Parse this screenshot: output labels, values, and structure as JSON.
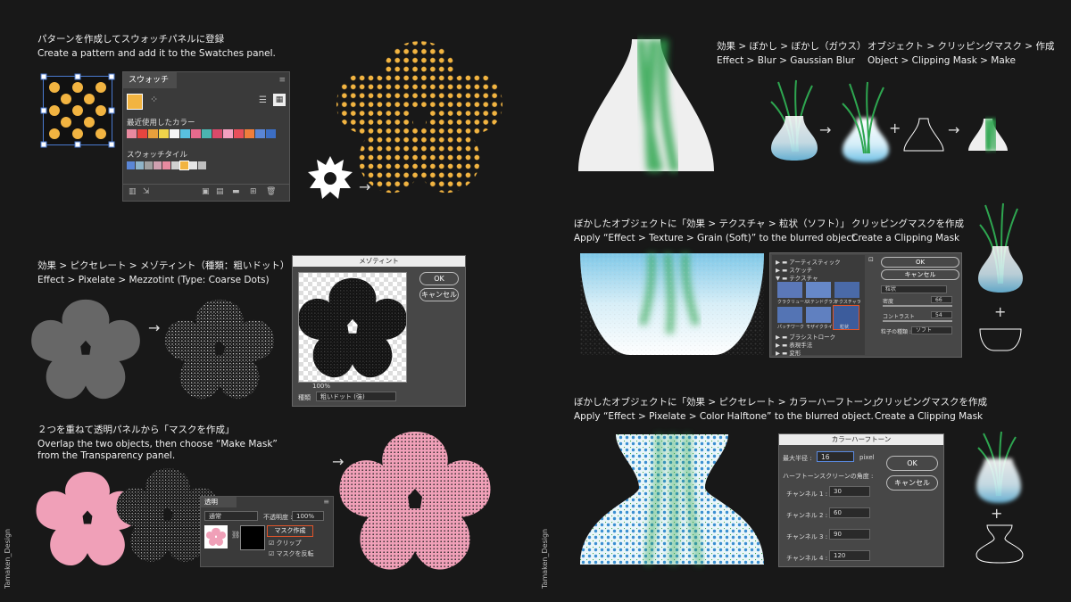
{
  "credits": {
    "left": "Tamaken_Design",
    "right": "Tamaken_Design"
  },
  "steps": {
    "s1": {
      "jp": "パターンを作成してスウォッチパネルに登録",
      "en": "Create a pattern and add it to the Swatches panel."
    },
    "s2": {
      "jp": "効果 > ピクセレート > メゾティント（種類：粗いドット）",
      "en": "Effect > Pixelate > Mezzotint (Type: Coarse Dots)"
    },
    "s3": {
      "jp": "２つを重ねて透明パネルから「マスクを作成」",
      "en1": "Overlap the two objects, then choose “Make Mask”",
      "en2": "from the Transparency panel."
    },
    "s4a": {
      "jp": "効果 > ぼかし > ぼかし（ガウス）",
      "en": "Effect > Blur > Gaussian Blur"
    },
    "s4b": {
      "jp": "オブジェクト > クリッピングマスク > 作成",
      "en": "Object > Clipping Mask > Make"
    },
    "s5a": {
      "jp": "ぼかしたオブジェクトに「効果 > テクスチャ > 粒状（ソフト）」",
      "en": "Apply “Effect > Texture > Grain (Soft)” to the blurred object."
    },
    "s5b": {
      "jp": "クリッピングマスクを作成",
      "en": "Create a Clipping Mask"
    },
    "s6a": {
      "jp": "ぼかしたオブジェクトに「効果 > ピクセレート > カラーハーフトーン」",
      "en": "Apply “Effect > Pixelate > Color Halftone” to the blurred object."
    },
    "s6b": {
      "jp": "クリッピングマスクを作成",
      "en": "Create a Clipping Mask"
    }
  },
  "swatches": {
    "title": "スウォッチ",
    "recent": "最近使用したカラー",
    "tiles": "スウォッチタイル",
    "colors": [
      "#e88aa0",
      "#e6453f",
      "#e8a03c",
      "#f0d44a",
      "#f7f7f7",
      "#59c1e0",
      "#e66a8d",
      "#4bb4b0",
      "#d84a6a",
      "#f3a0c0",
      "#e94f5a",
      "#f07e3c",
      "#5a86d6",
      "#3c6ec4"
    ]
  },
  "mezzotint": {
    "title": "メゾティント",
    "ok": "OK",
    "cancel": "キャンセル",
    "zoom": "100%",
    "type_label": "種類",
    "type_value": "粗いドット (強)"
  },
  "transparency": {
    "title": "透明",
    "mode": "通常",
    "opacity_label": "不透明度 :",
    "opacity_value": "100%",
    "make_mask": "マスク作成",
    "clip": "クリップ",
    "invert": "マスクを反転"
  },
  "grain": {
    "folders": [
      "アーティスティック",
      "スケッチ",
      "テクスチャ",
      "ブラシストローク",
      "表現手法",
      "変形"
    ],
    "thumbs": [
      "クラクリュール",
      "ステンドグラス",
      "テクスチャライザー",
      "パッチワーク",
      "モザイクタイル",
      "粒状"
    ],
    "ok": "OK",
    "cancel": "キャンセル",
    "filter": "粒状",
    "density_label": "密度",
    "density": "66",
    "contrast_label": "コントラスト",
    "contrast": "54",
    "type_label": "粒子の種類 :",
    "type_value": "ソフト"
  },
  "halftone": {
    "title": "カラーハーフトーン",
    "radius_label": "最大半径 :",
    "radius": "16",
    "unit": "pixel",
    "angles_label": "ハーフトーンスクリーンの角度 :",
    "channels": [
      {
        "label": "チャンネル 1 :",
        "value": "30"
      },
      {
        "label": "チャンネル 2 :",
        "value": "60"
      },
      {
        "label": "チャンネル 3 :",
        "value": "90"
      },
      {
        "label": "チャンネル 4 :",
        "value": "120"
      }
    ],
    "ok": "OK",
    "cancel": "キャンセル"
  },
  "colors": {
    "orange": "#f2b441",
    "pink": "#f0a0b8",
    "green": "#2ea650",
    "blue": "#7ec8e8"
  }
}
